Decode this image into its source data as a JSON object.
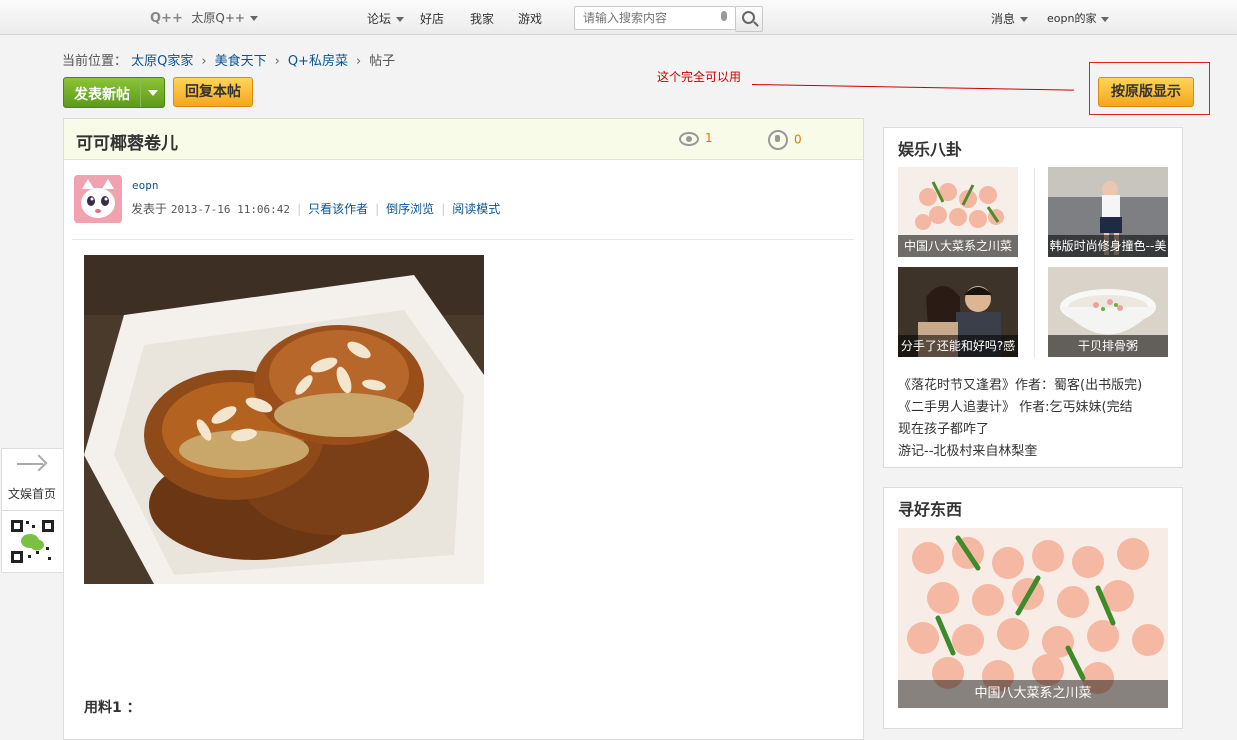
{
  "topnav": {
    "logo": "Q++",
    "city": "太原Q++",
    "items": [
      "论坛",
      "好店",
      "我家",
      "游戏"
    ],
    "search_placeholder": "请输入搜索内容",
    "messages": "消息",
    "user": "eopn的家"
  },
  "breadcrumb": {
    "prefix": "当前位置：",
    "links": [
      "太原Q家家",
      "美食天下",
      "Q+私房菜"
    ],
    "current": "帖子"
  },
  "actions": {
    "new_post": "发表新帖",
    "reply": "回复本帖",
    "original_view": "按原版显示",
    "annotation": "这个完全可以用"
  },
  "post": {
    "title": "可可椰蓉卷儿",
    "views": "1",
    "replies": "0",
    "author": "eopn",
    "posted_label": "发表于",
    "posted_at": "2013-7-16 11:06:42",
    "links": [
      "只看该作者",
      "倒序浏览",
      "阅读模式"
    ],
    "ingredients_label": "用料1 ："
  },
  "float": {
    "home_label": "文娱首页"
  },
  "sidebar": {
    "entertainment": {
      "title": "娱乐八卦",
      "thumbs": [
        {
          "caption": "中国八大菜系之川菜"
        },
        {
          "caption": "韩版时尚修身撞色--美"
        },
        {
          "caption": "分手了还能和好吗?感"
        },
        {
          "caption": "干贝排骨粥"
        }
      ],
      "links": [
        "《落花时节又逢君》作者：蜀客(出书版完)",
        "《二手男人追妻计》 作者:乞丐妹妹(完结",
        "现在孩子都咋了",
        "游记--北极村来自林梨奎"
      ]
    },
    "find": {
      "title": "寻好东西",
      "caption": "中国八大菜系之川菜"
    }
  }
}
